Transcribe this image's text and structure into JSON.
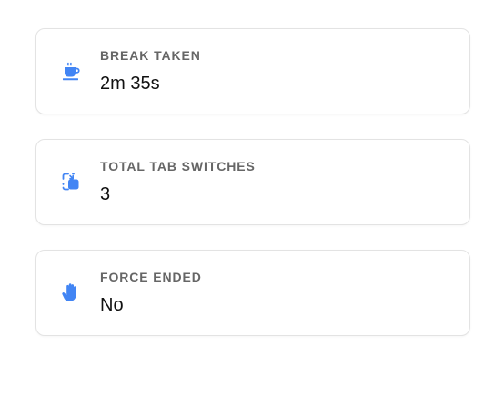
{
  "colors": {
    "accent": "#4285f4",
    "label": "#666666",
    "value": "#111111",
    "card_border": "#e3e3e3"
  },
  "stats": [
    {
      "icon": "coffee-cup-icon",
      "label": "BREAK TAKEN",
      "value": "2m 35s"
    },
    {
      "icon": "tab-switch-icon",
      "label": "TOTAL TAB SWITCHES",
      "value": "3"
    },
    {
      "icon": "raised-hand-icon",
      "label": "FORCE ENDED",
      "value": "No"
    }
  ]
}
